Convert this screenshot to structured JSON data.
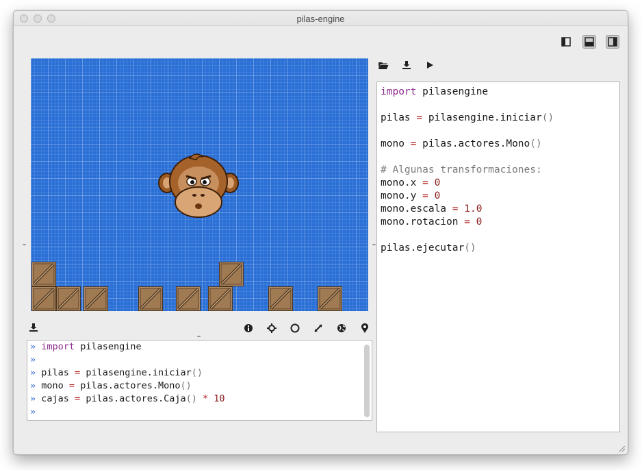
{
  "window": {
    "title": "pilas-engine"
  },
  "colors": {
    "stage_bg": "#2a6fd6",
    "keyword": "#8b2b8b",
    "number": "#8b1a1a",
    "prompt": "#3f73d8",
    "comment": "#7a7a7a"
  },
  "layout_buttons": [
    "layout-left-panel-icon",
    "layout-bottom-panel-icon",
    "layout-right-panel-icon"
  ],
  "editor_toolbar": [
    "folder-open-icon",
    "save-icon",
    "play-icon"
  ],
  "stage_toolbar": [
    "info-icon",
    "crosshair-icon",
    "circle-icon",
    "fullscreen-icon",
    "globe-icon",
    "location-pin-icon"
  ],
  "console": {
    "prompt": "»",
    "lines": [
      {
        "kw": "import",
        "rest": " pilasengine"
      },
      {
        "code": ""
      },
      {
        "code": "pilas ",
        "op": "=",
        "code2": " pilasengine.iniciar",
        "paren": "()"
      },
      {
        "code": "mono ",
        "op": "=",
        "code2": " pilas.actores.Mono",
        "paren": "()"
      },
      {
        "code": "cajas ",
        "op": "=",
        "code2": " pilas.actores.Caja",
        "paren": "()",
        "op2": " * ",
        "num": "10"
      },
      {
        "code": ""
      }
    ]
  },
  "editor": {
    "l1_kw": "import",
    "l1_rest": " pilasengine",
    "l3_a": "pilas ",
    "l3_op": "=",
    "l3_b": " pilasengine.iniciar",
    "l3_paren": "()",
    "l5_a": "mono ",
    "l5_op": "=",
    "l5_b": " pilas.actores.Mono",
    "l5_paren": "()",
    "l7_comment": "# Algunas transformaciones:",
    "l8_a": "mono.x ",
    "l8_op": "=",
    "l8_num": " 0",
    "l9_a": "mono.y ",
    "l9_op": "=",
    "l9_num": " 0",
    "l10_a": "mono.escala ",
    "l10_op": "=",
    "l10_num": " 1.0",
    "l11_a": "mono.rotacion ",
    "l11_op": "=",
    "l11_num": " 0",
    "l13_a": "pilas.ejecutar",
    "l13_paren": "()"
  }
}
